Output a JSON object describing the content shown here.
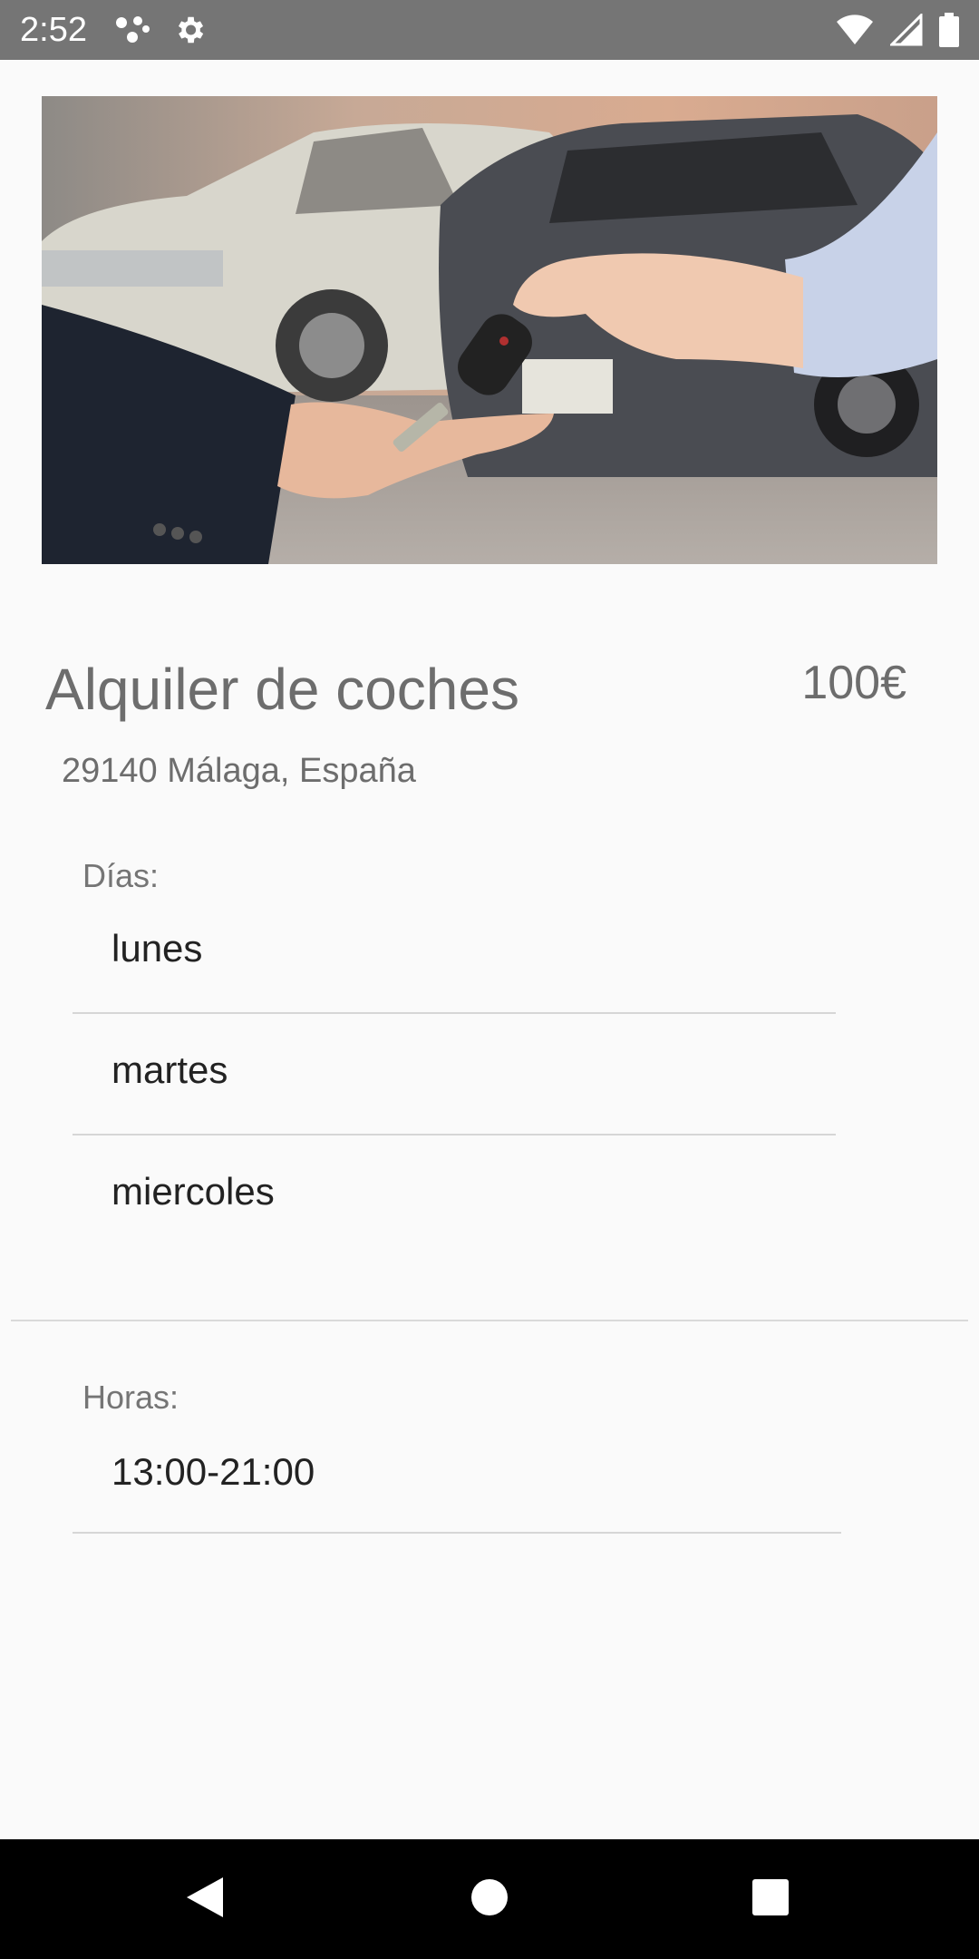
{
  "status_bar": {
    "time": "2:52",
    "icons_left": [
      "network-nodes-icon",
      "gear-icon"
    ],
    "icons_right": [
      "wifi-icon",
      "signal-icon",
      "battery-icon"
    ]
  },
  "hero": {
    "icon": "car-keys-handover-photo"
  },
  "listing": {
    "title": "Alquiler de coches",
    "price": "100€",
    "address": "29140 Málaga, España"
  },
  "days": {
    "label": "Días:",
    "items": [
      "lunes",
      "martes",
      "miercoles"
    ]
  },
  "hours": {
    "label": "Horas:",
    "value": "13:00-21:00"
  },
  "nav_bar": {
    "buttons": [
      "back-icon",
      "home-icon",
      "recents-icon"
    ]
  },
  "colors": {
    "status_bar": "#757575",
    "background": "#fafafa",
    "nav_bar": "#000000",
    "secondary_text": "#6d6d6d",
    "primary_text": "#222222"
  }
}
